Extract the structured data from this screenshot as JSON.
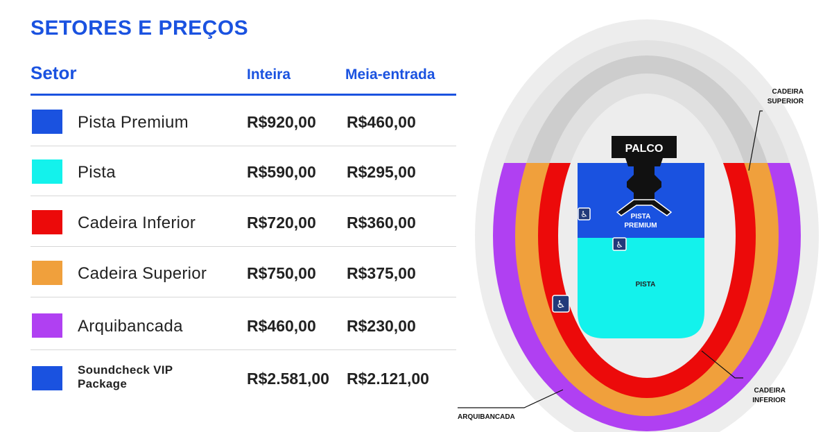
{
  "title": "SETORES E PREÇOS",
  "table": {
    "headers": {
      "setor": "Setor",
      "inteira": "Inteira",
      "meia": "Meia-entrada"
    },
    "rows": [
      {
        "name": "Pista Premium",
        "inteira": "R$920,00",
        "meia": "R$460,00",
        "color": "#1a52e0"
      },
      {
        "name": "Pista",
        "inteira": "R$590,00",
        "meia": "R$295,00",
        "color": "#13f2ec"
      },
      {
        "name": "Cadeira Inferior",
        "inteira": "R$720,00",
        "meia": "R$360,00",
        "color": "#ec0a0a"
      },
      {
        "name": "Cadeira Superior",
        "inteira": "R$750,00",
        "meia": "R$375,00",
        "color": "#f0a03c"
      },
      {
        "name": "Arquibancada",
        "inteira": "R$460,00",
        "meia": "R$230,00",
        "color": "#b040f2"
      },
      {
        "name": "Soundcheck VIP Package",
        "inteira": "R$2.581,00",
        "meia": "R$2.121,00",
        "color": "#1a52e0"
      }
    ]
  },
  "map": {
    "stage_label": "PALCO",
    "pista_premium_label": "PISTA PREMIUM",
    "pista_premium_line1": "PISTA",
    "pista_premium_line2": "PREMIUM",
    "pista_label": "PISTA",
    "cadeira_superior_line1": "CADEIRA",
    "cadeira_superior_line2": "SUPERIOR",
    "cadeira_inferior_line1": "CADEIRA",
    "cadeira_inferior_line2": "INFERIOR",
    "arquibancada_label": "ARQUIBANCADA",
    "accessibility_icon": "wheelchair-icon"
  }
}
